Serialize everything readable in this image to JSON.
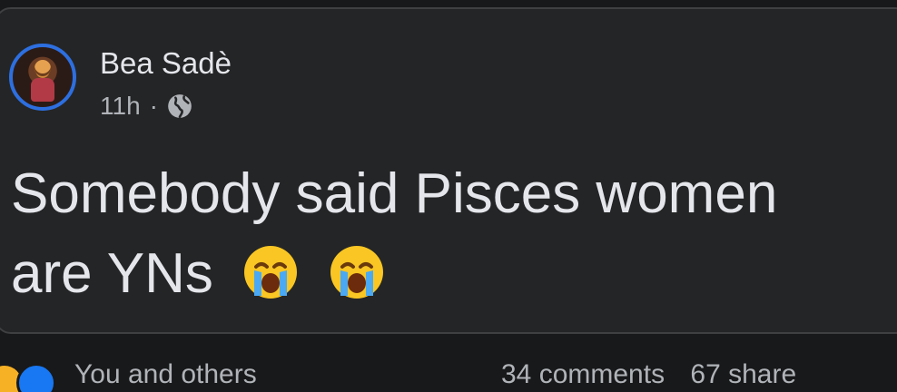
{
  "post": {
    "author": "Bea Sadè",
    "time": "11h",
    "separator": "·",
    "privacy_icon": "globe-icon",
    "text": "Somebody said Pisces women are YNs",
    "emojis": [
      "loudly-crying-face-emoji",
      "loudly-crying-face-emoji"
    ]
  },
  "footer": {
    "reaction_icons": [
      "haha-reaction-icon",
      "like-reaction-icon"
    ],
    "reaction_label": "You and others",
    "comments": "34 comments",
    "shares": "67 share"
  },
  "colors": {
    "background": "#18191a",
    "card": "#242526",
    "avatar_ring": "#2d6fe0",
    "primary_text": "#e4e6eb",
    "secondary_text": "#b0b3b8"
  }
}
